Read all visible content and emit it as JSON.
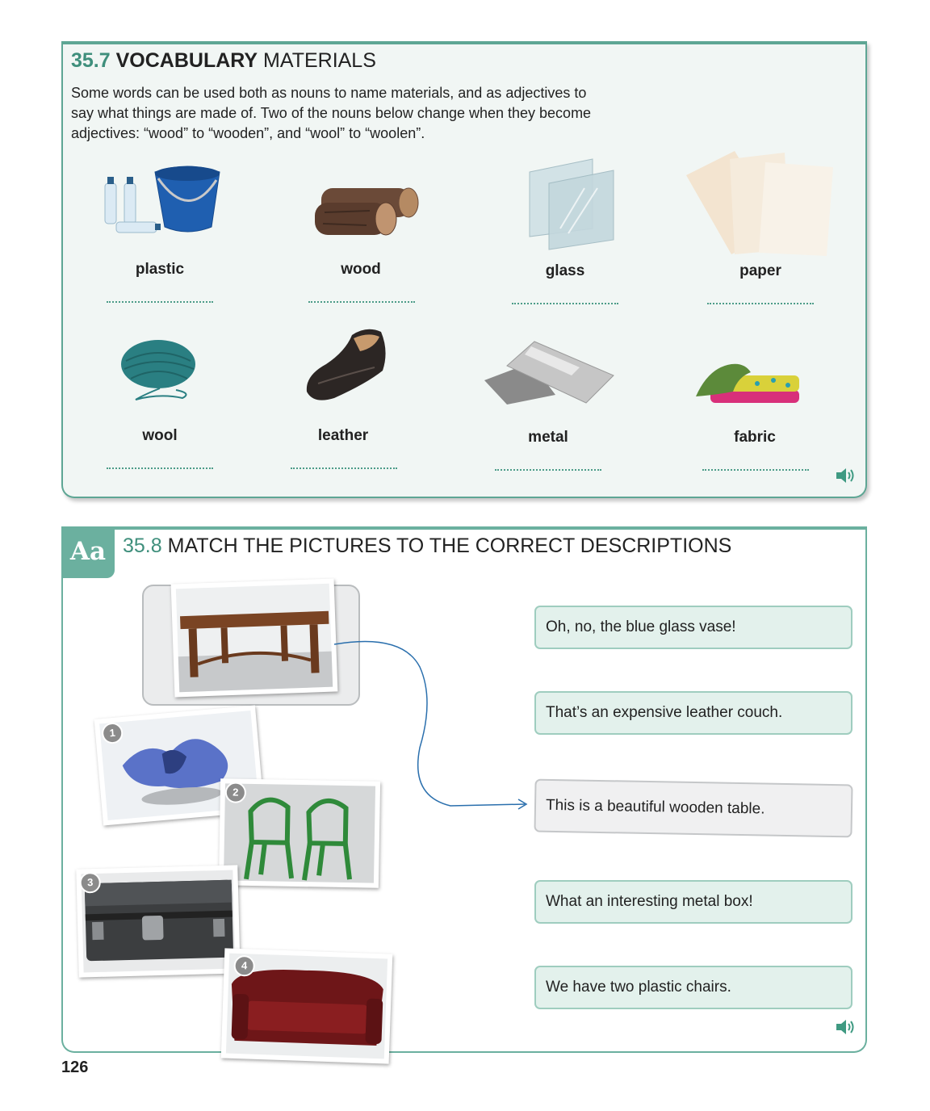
{
  "section_357": {
    "number": "35.7",
    "title_bold": "VOCABULARY",
    "title_rest": "MATERIALS",
    "intro": "Some words can be used both as nouns to name materials, and as adjectives to say what things are made of. Two of the nouns below change when they become adjectives: “wood” to “wooden”, and “wool” to “woolen”.",
    "materials": [
      {
        "label": "plastic",
        "icon": "plastic-bottles-bucket-icon"
      },
      {
        "label": "wood",
        "icon": "wood-logs-icon"
      },
      {
        "label": "glass",
        "icon": "glass-panes-icon"
      },
      {
        "label": "paper",
        "icon": "paper-sheets-icon"
      },
      {
        "label": "wool",
        "icon": "yarn-ball-icon"
      },
      {
        "label": "leather",
        "icon": "leather-shoe-icon"
      },
      {
        "label": "metal",
        "icon": "metal-sheets-icon"
      },
      {
        "label": "fabric",
        "icon": "folded-fabric-icon"
      }
    ],
    "audio_icon": "speaker-icon"
  },
  "section_358": {
    "badge": "Aa",
    "number": "35.8",
    "title": "MATCH THE PICTURES TO THE CORRECT DESCRIPTIONS",
    "pictures": [
      {
        "number": "",
        "subject": "wooden table"
      },
      {
        "number": "1",
        "subject": "broken blue glass vase"
      },
      {
        "number": "2",
        "subject": "green plastic chairs"
      },
      {
        "number": "3",
        "subject": "metal box"
      },
      {
        "number": "4",
        "subject": "leather couch"
      }
    ],
    "descriptions": [
      "Oh, no, the blue glass vase!",
      "That’s an expensive leather couch.",
      "This is a beautiful wooden table.",
      "What an interesting metal box!",
      "We have two plastic chairs."
    ],
    "audio_icon": "speaker-icon"
  },
  "page_number": "126"
}
